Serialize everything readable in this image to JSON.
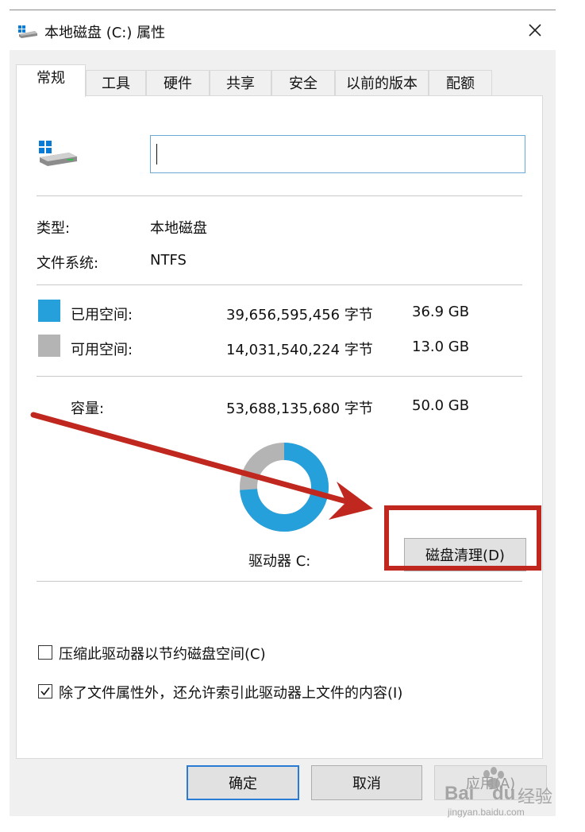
{
  "window": {
    "title": "本地磁盘 (C:) 属性"
  },
  "tabs": [
    {
      "label": "常规",
      "active": true
    },
    {
      "label": "工具"
    },
    {
      "label": "硬件"
    },
    {
      "label": "共享"
    },
    {
      "label": "安全"
    },
    {
      "label": "以前的版本"
    },
    {
      "label": "配额"
    }
  ],
  "general": {
    "name_value": "",
    "type_label": "类型:",
    "type_value": "本地磁盘",
    "fs_label": "文件系统:",
    "fs_value": "NTFS",
    "used_label": "已用空间:",
    "used_bytes": "39,656,595,456 字节",
    "used_size": "36.9 GB",
    "free_label": "可用空间:",
    "free_bytes": "14,031,540,224 字节",
    "free_size": "13.0 GB",
    "capacity_label": "容量:",
    "capacity_bytes": "53,688,135,680 字节",
    "capacity_size": "50.0 GB",
    "drive_label": "驱动器 C:",
    "cleanup_button": "磁盘清理(D)",
    "used_fraction": 0.738,
    "compress_label": "压缩此驱动器以节约磁盘空间(C)",
    "compress_checked": false,
    "index_label": "除了文件属性外，还允许索引此驱动器上文件的内容(I)",
    "index_checked": true
  },
  "buttons": {
    "ok": "确定",
    "cancel": "取消",
    "apply": "应用(A)"
  },
  "colors": {
    "used": "#26a0da",
    "free": "#b4b4b4",
    "annotation": "#c0281f",
    "input_border": "#6aa9d8"
  },
  "icons": {
    "title": "drive-icon",
    "close": "close-icon",
    "drive": "drive-icon",
    "checkbox": "checkmark-icon"
  },
  "watermark": {
    "brand": "Bai",
    "brand2": "du",
    "suffix": "经验",
    "url": "jingyan.baidu.com"
  }
}
